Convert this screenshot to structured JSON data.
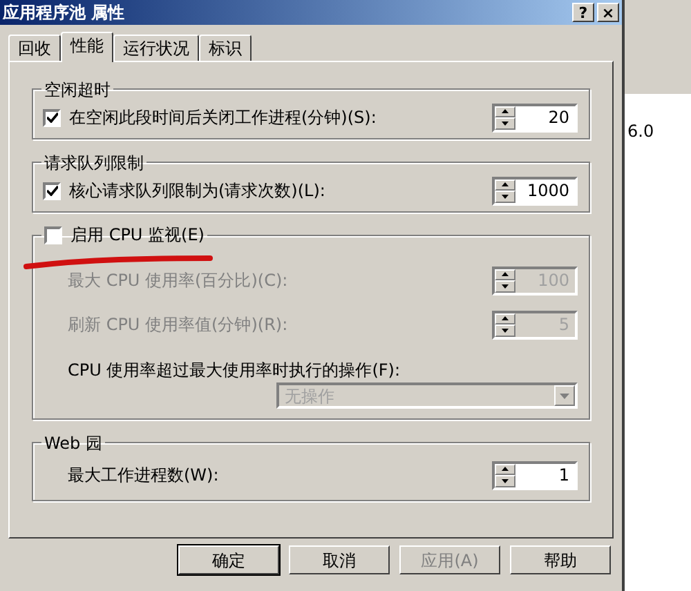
{
  "window": {
    "title": "应用程序池 属性",
    "buttons": [
      "?",
      "×"
    ]
  },
  "tabs": [
    {
      "label": "回收",
      "selected": false
    },
    {
      "label": "性能",
      "selected": true
    },
    {
      "label": "运行状况",
      "selected": false
    },
    {
      "label": "标识",
      "selected": false
    }
  ],
  "groups": [
    {
      "kind": "plain",
      "legend": "空闲超时",
      "rows": [
        {
          "kind": "checkbox_spinner",
          "label": "在空闲此段时间后关闭工作进程(分钟)(S):",
          "checked": true,
          "value": "20",
          "disabled": false
        }
      ]
    },
    {
      "kind": "plain",
      "legend": "请求队列限制",
      "rows": [
        {
          "kind": "checkbox_spinner",
          "label": "核心请求队列限制为(请求次数)(L):",
          "checked": true,
          "value": "1000",
          "disabled": false
        }
      ]
    },
    {
      "kind": "checkbox",
      "legend": "启用 CPU 监视(E)",
      "checked": false,
      "rows": [
        {
          "kind": "spinner",
          "label": "最大 CPU 使用率(百分比)(C):",
          "value": "100",
          "disabled": true
        },
        {
          "kind": "spinner",
          "label": "刷新 CPU 使用率值(分钟)(R):",
          "value": "5",
          "disabled": true
        },
        {
          "kind": "label",
          "label": "CPU 使用率超过最大使用率时执行的操作(F):",
          "disabled": false
        },
        {
          "kind": "dropdown",
          "value": "无操作",
          "disabled": true
        }
      ]
    },
    {
      "kind": "plain",
      "legend": "Web 园",
      "rows": [
        {
          "kind": "spinner",
          "label": "最大工作进程数(W):",
          "value": "1",
          "disabled": false
        }
      ]
    }
  ],
  "buttons": [
    {
      "label": "确定",
      "disabled": false,
      "default": true
    },
    {
      "label": "取消",
      "disabled": false,
      "default": false
    },
    {
      "label": "应用(A)",
      "disabled": true,
      "default": false
    },
    {
      "label": "帮助",
      "disabled": false,
      "default": false
    }
  ],
  "background_window": {
    "text": "6.0"
  }
}
